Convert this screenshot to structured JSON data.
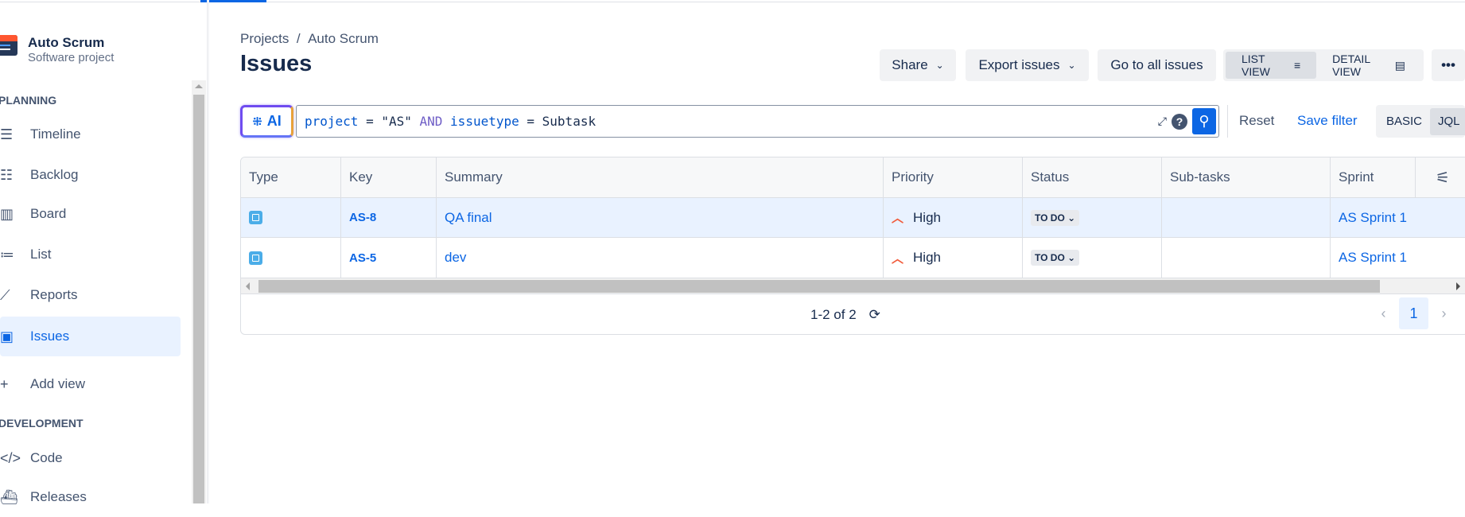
{
  "project": {
    "name": "Auto Scrum",
    "type": "Software project"
  },
  "sidebar": {
    "sections": [
      "PLANNING",
      "DEVELOPMENT"
    ],
    "items": [
      {
        "label": "Timeline",
        "icon": "timeline-icon"
      },
      {
        "label": "Backlog",
        "icon": "backlog-icon"
      },
      {
        "label": "Board",
        "icon": "board-icon"
      },
      {
        "label": "List",
        "icon": "list-icon"
      },
      {
        "label": "Reports",
        "icon": "reports-icon"
      },
      {
        "label": "Issues",
        "icon": "issues-icon"
      },
      {
        "label": "Add view",
        "icon": "plus-icon"
      },
      {
        "label": "Code",
        "icon": "code-icon"
      },
      {
        "label": "Releases",
        "icon": "releases-icon"
      }
    ]
  },
  "breadcrumb": {
    "root": "Projects",
    "sep": "/",
    "current": "Auto Scrum"
  },
  "header": {
    "title": "Issues",
    "share": "Share",
    "export": "Export issues",
    "go_all": "Go to all issues",
    "list_view": "LIST VIEW",
    "detail_view": "DETAIL VIEW",
    "more": "•••"
  },
  "search": {
    "ai": "AI",
    "jql": {
      "t1": "project",
      "t2": " = ",
      "t3": "\"AS\"",
      "t4": " AND ",
      "t5": "issuetype",
      "t6": " = ",
      "t7": "Subtask"
    },
    "reset": "Reset",
    "save_filter": "Save filter",
    "basic": "BASIC",
    "jql_label": "JQL"
  },
  "table": {
    "columns": [
      "Type",
      "Key",
      "Summary",
      "Priority",
      "Status",
      "Sub-tasks",
      "Sprint"
    ],
    "rows": [
      {
        "key": "AS-8",
        "summary": "QA final",
        "priority": "High",
        "status": "TO DO",
        "subtasks": "",
        "sprint": "AS Sprint 1"
      },
      {
        "key": "AS-5",
        "summary": "dev",
        "priority": "High",
        "status": "TO DO",
        "subtasks": "",
        "sprint": "AS Sprint 1"
      }
    ]
  },
  "pagination": {
    "range": "1-2 of 2",
    "current_page": "1"
  },
  "colors": {
    "accent": "#0c66e4",
    "selected_bg": "#e9f2ff",
    "priority_high": "#f15b3b"
  }
}
